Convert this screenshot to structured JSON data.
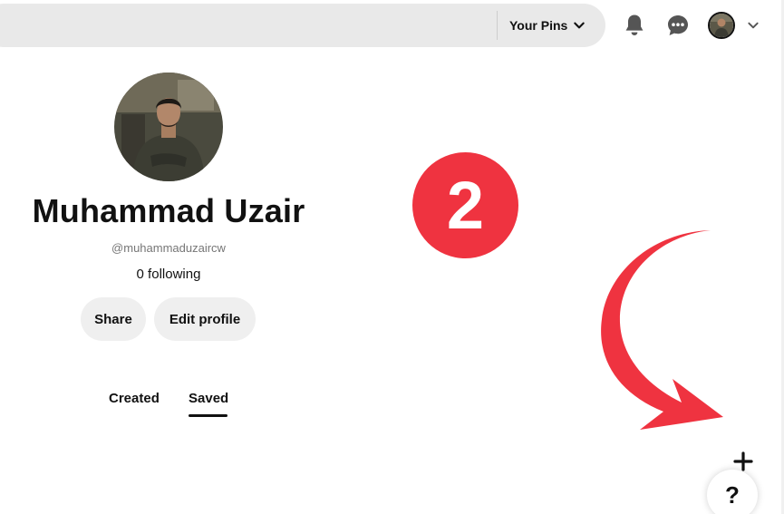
{
  "header": {
    "your_pins_label": "Your Pins",
    "icons": [
      "bell-icon",
      "chat-icon",
      "chevron-down-icon"
    ]
  },
  "profile": {
    "name": "Muhammad Uzair",
    "handle": "@muhammaduzaircw",
    "following": "0 following",
    "share_label": "Share",
    "edit_label": "Edit profile"
  },
  "tabs": [
    {
      "label": "Created",
      "active": false
    },
    {
      "label": "Saved",
      "active": true
    }
  ],
  "annotation": {
    "step_number": "2",
    "accent_color": "#ef3340"
  },
  "fab": {
    "plus_icon": "plus-icon",
    "help_label": "?"
  }
}
